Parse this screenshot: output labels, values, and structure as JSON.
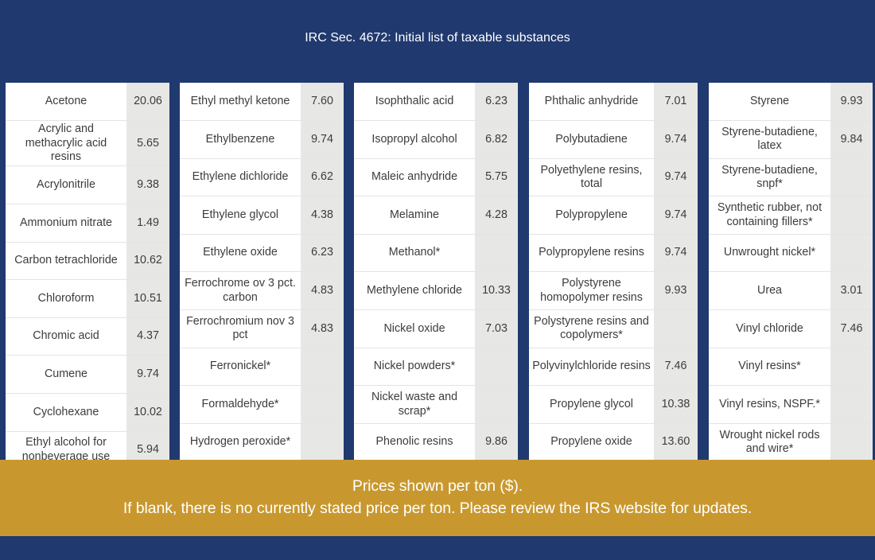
{
  "header": {
    "title": "IRC Sec. 4672: Initial list of taxable substances"
  },
  "theme": {
    "navy": "#20396f",
    "gold": "#c8982f",
    "cell_name_bg": "#ffffff",
    "cell_price_bg": "#e7e7e6",
    "cell_text": "#3c3c3c"
  },
  "footer": {
    "line1": "Prices shown per ton ($).",
    "line2": "If blank, there is no currently stated price per ton. Please review the IRS website for updates."
  },
  "columns": [
    {
      "id": "col-1",
      "rows": [
        {
          "substance": "Acetone",
          "price": "20.06"
        },
        {
          "substance": "Acrylic and methacrylic acid resins",
          "price": "5.65"
        },
        {
          "substance": "Acrylonitrile",
          "price": "9.38"
        },
        {
          "substance": "Ammonium nitrate",
          "price": "1.49"
        },
        {
          "substance": "Carbon tetrachloride",
          "price": "10.62"
        },
        {
          "substance": "Chloroform",
          "price": "10.51"
        },
        {
          "substance": "Chromic acid",
          "price": "4.37"
        },
        {
          "substance": "Cumene",
          "price": "9.74"
        },
        {
          "substance": "Cyclohexane",
          "price": "10.02"
        },
        {
          "substance": "Ethyl alcohol for nonbeverage use",
          "price": "5.94"
        }
      ]
    },
    {
      "id": "col-2",
      "rows": [
        {
          "substance": "Ethyl methyl ketone",
          "price": "7.60"
        },
        {
          "substance": "Ethylbenzene",
          "price": "9.74"
        },
        {
          "substance": "Ethylene dichloride",
          "price": "6.62"
        },
        {
          "substance": "Ethylene glycol",
          "price": "4.38"
        },
        {
          "substance": "Ethylene oxide",
          "price": "6.23"
        },
        {
          "substance": "Ferrochrome ov 3 pct. carbon",
          "price": "4.83"
        },
        {
          "substance": "Ferrochromium nov 3 pct",
          "price": "4.83"
        },
        {
          "substance": "Ferronickel*",
          "price": ""
        },
        {
          "substance": "Formaldehyde*",
          "price": ""
        },
        {
          "substance": "Hydrogen peroxide*",
          "price": ""
        }
      ]
    },
    {
      "id": "col-3",
      "rows": [
        {
          "substance": "Isophthalic acid",
          "price": "6.23"
        },
        {
          "substance": "Isopropyl alcohol",
          "price": "6.82"
        },
        {
          "substance": "Maleic anhydride",
          "price": "5.75"
        },
        {
          "substance": "Melamine",
          "price": "4.28"
        },
        {
          "substance": "Methanol*",
          "price": ""
        },
        {
          "substance": "Methylene chloride",
          "price": "10.33"
        },
        {
          "substance": "Nickel oxide",
          "price": "7.03"
        },
        {
          "substance": "Nickel powders*",
          "price": ""
        },
        {
          "substance": "Nickel waste and scrap*",
          "price": ""
        },
        {
          "substance": "Phenolic resins",
          "price": "9.86"
        }
      ]
    },
    {
      "id": "col-4",
      "rows": [
        {
          "substance": "Phthalic anhydride",
          "price": "7.01"
        },
        {
          "substance": "Polybutadiene",
          "price": "9.74"
        },
        {
          "substance": "Polyethylene resins, total",
          "price": "9.74"
        },
        {
          "substance": "Polypropylene",
          "price": "9.74"
        },
        {
          "substance": "Polypropylene resins",
          "price": "9.74"
        },
        {
          "substance": "Polystyrene homopolymer resins",
          "price": "9.93"
        },
        {
          "substance": "Polystyrene resins and copolymers*",
          "price": ""
        },
        {
          "substance": "Polyvinylchloride resins",
          "price": "7.46"
        },
        {
          "substance": "Propylene glycol",
          "price": "10.38"
        },
        {
          "substance": "Propylene oxide",
          "price": "13.60"
        }
      ]
    },
    {
      "id": "col-5",
      "rows": [
        {
          "substance": "Styrene",
          "price": "9.93"
        },
        {
          "substance": "Styrene-butadiene, latex",
          "price": "9.84"
        },
        {
          "substance": "Styrene-butadiene, snpf*",
          "price": ""
        },
        {
          "substance": "Synthetic rubber, not containing fillers*",
          "price": ""
        },
        {
          "substance": "Unwrought nickel*",
          "price": ""
        },
        {
          "substance": "Urea",
          "price": "3.01"
        },
        {
          "substance": "Vinyl chloride",
          "price": "7.46"
        },
        {
          "substance": "Vinyl resins*",
          "price": ""
        },
        {
          "substance": "Vinyl resins, NSPF.*",
          "price": ""
        },
        {
          "substance": "Wrought nickel rods and wire*",
          "price": ""
        }
      ]
    }
  ]
}
